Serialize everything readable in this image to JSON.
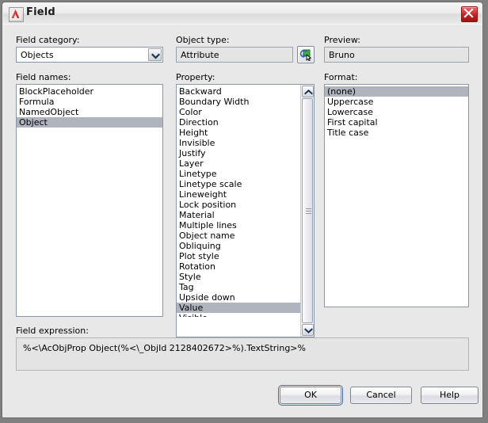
{
  "window": {
    "title": "Field",
    "logo_icon": "autocad-a-logo",
    "close_icon": "close-x-icon"
  },
  "field_category": {
    "label": "Field category:",
    "selected": "Objects",
    "dropdown_icon": "chevron-down-icon"
  },
  "field_names": {
    "label": "Field names:",
    "items": [
      "BlockPlaceholder",
      "Formula",
      "NamedObject",
      "Object"
    ],
    "selected": "Object"
  },
  "object_type": {
    "label": "Object type:",
    "value": "Attribute",
    "pick_button_icon": "select-object-icon"
  },
  "property": {
    "label": "Property:",
    "items": [
      "Backward",
      "Boundary Width",
      "Color",
      "Direction",
      "Height",
      "Invisible",
      "Justify",
      "Layer",
      "Linetype",
      "Linetype scale",
      "Lineweight",
      "Lock position",
      "Material",
      "Multiple lines",
      "Object name",
      "Obliquing",
      "Plot style",
      "Rotation",
      "Style",
      "Tag",
      "Upside down",
      "Value"
    ],
    "selected": "Value",
    "clipped_next_item": "Visible",
    "scroll_up_icon": "chevron-up-icon",
    "scroll_down_icon": "chevron-down-icon"
  },
  "preview": {
    "label": "Preview:",
    "value": "Bruno"
  },
  "format": {
    "label": "Format:",
    "items": [
      "(none)",
      "Uppercase",
      "Lowercase",
      "First capital",
      "Title case"
    ],
    "selected": "(none)"
  },
  "field_expression": {
    "label": "Field expression:",
    "value": "%<\\AcObjProp Object(%<\\_ObjId 2128402672>%).TextString>%"
  },
  "buttons": {
    "ok": "OK",
    "cancel": "Cancel",
    "help": "Help"
  },
  "colors": {
    "dialog_bg": "#e8e8e8",
    "selection": "#b0b4bd",
    "logo_red": "#cc2222",
    "close_red": "#c42222",
    "listbox_border": "#8a97a8"
  }
}
